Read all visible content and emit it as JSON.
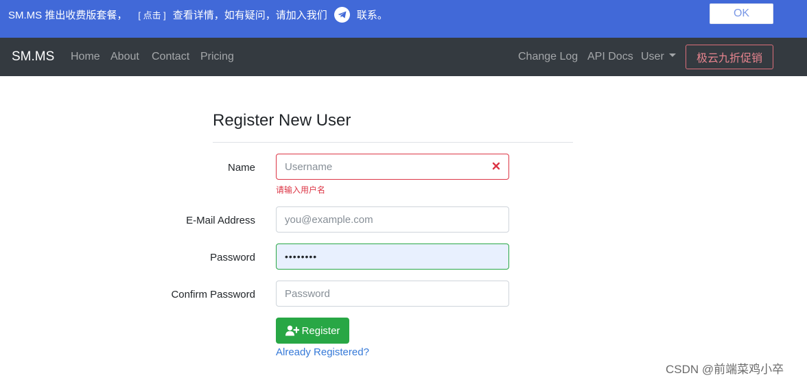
{
  "announcement": {
    "text": "SM.MS 推出收费版套餐，",
    "link": "[ 点击 ]",
    "text2": "查看详情，如有疑问，请加入我们",
    "text3": "联系。",
    "ok_label": "OK",
    "icon": "telegram-icon"
  },
  "navbar": {
    "brand": "SM.MS",
    "left_items": [
      "Home",
      "About",
      "Contact",
      "Pricing"
    ],
    "right_items": [
      "Change Log",
      "API Docs"
    ],
    "user_label": "User",
    "promo_label": "极云九折促销"
  },
  "form": {
    "title": "Register New User",
    "name": {
      "label": "Name",
      "placeholder": "Username",
      "error": "请输入用户名",
      "state": "invalid"
    },
    "email": {
      "label": "E-Mail Address",
      "placeholder": "you@example.com"
    },
    "password": {
      "label": "Password",
      "value": "••••••••",
      "state": "valid"
    },
    "confirm": {
      "label": "Confirm Password",
      "placeholder": "Password"
    },
    "register_label": "Register",
    "already_label": "Already Registered?"
  },
  "watermark": "CSDN @前端菜鸡小卒",
  "colors": {
    "announce_bg": "#4169d8",
    "navbar_bg": "#343a40",
    "success": "#28a745",
    "danger": "#dc3545",
    "link": "#3579d8"
  }
}
